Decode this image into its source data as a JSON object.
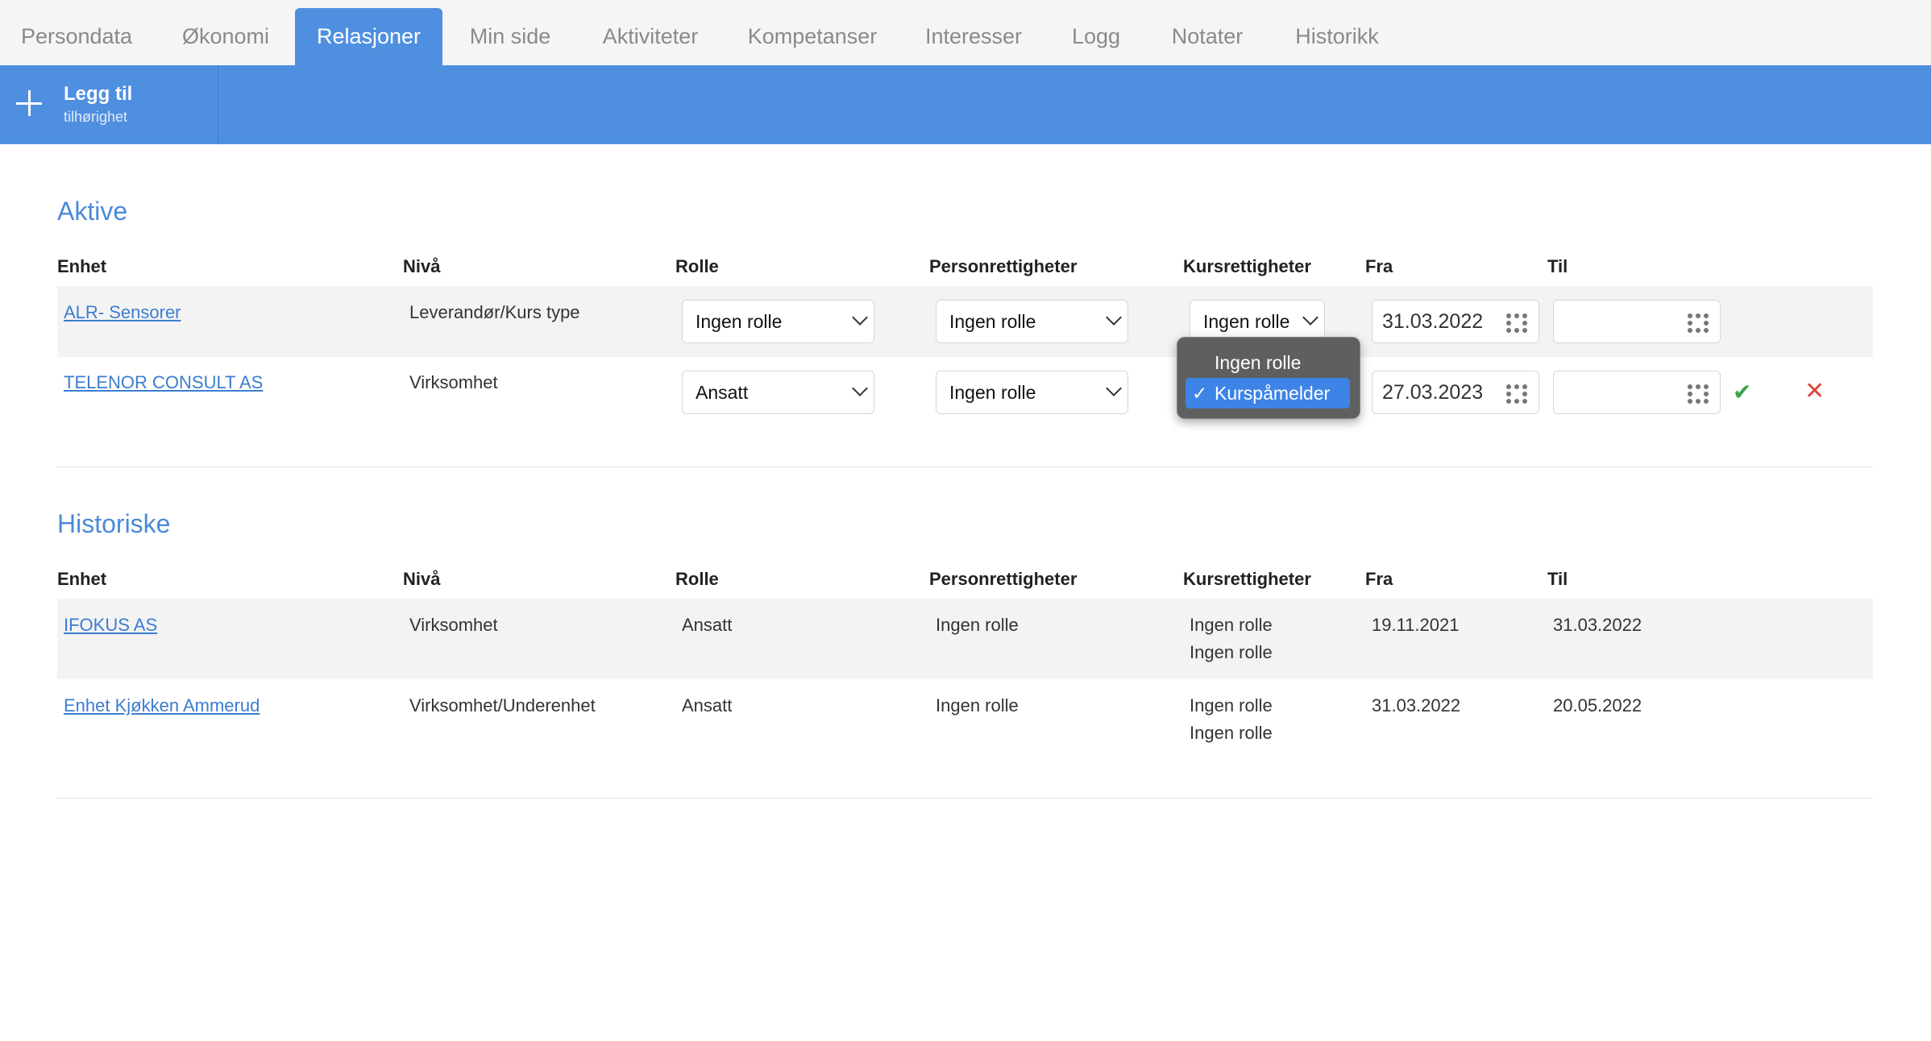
{
  "tabs": [
    {
      "label": "Persondata"
    },
    {
      "label": "Økonomi"
    },
    {
      "label": "Relasjoner"
    },
    {
      "label": "Min side"
    },
    {
      "label": "Aktiviteter"
    },
    {
      "label": "Kompetanser"
    },
    {
      "label": "Interesser"
    },
    {
      "label": "Logg"
    },
    {
      "label": "Notater"
    },
    {
      "label": "Historikk"
    }
  ],
  "toolbar": {
    "add_title": "Legg til",
    "add_sub": "tilhørighet"
  },
  "columns": {
    "enhet": "Enhet",
    "niva": "Nivå",
    "rolle": "Rolle",
    "personrett": "Personrettigheter",
    "kursrett": "Kursrettigheter",
    "fra": "Fra",
    "til": "Til"
  },
  "aktive": {
    "title": "Aktive",
    "rows": [
      {
        "enhet": "ALR- Sensorer",
        "niva": "Leverandør/Kurs type",
        "rolle": "Ingen rolle",
        "personrett": "Ingen rolle",
        "kursrett": "Ingen rolle",
        "fra": "31.03.2022",
        "til": ""
      },
      {
        "enhet": "TELENOR CONSULT AS",
        "niva": "Virksomhet",
        "rolle": "Ansatt",
        "personrett": "Ingen rolle",
        "kursrett": "Kurspåmelder",
        "fra": "27.03.2023",
        "til": ""
      }
    ]
  },
  "dropdown": {
    "options": [
      "Ingen rolle",
      "Kurspåmelder"
    ],
    "selected": "Kurspåmelder"
  },
  "historiske": {
    "title": "Historiske",
    "rows": [
      {
        "enhet": "IFOKUS AS",
        "niva": "Virksomhet",
        "rolle": "Ansatt",
        "personrett": "Ingen rolle",
        "kursrett1": "Ingen rolle",
        "kursrett2": "Ingen rolle",
        "fra": "19.11.2021",
        "til": "31.03.2022"
      },
      {
        "enhet": "Enhet Kjøkken Ammerud",
        "niva": "Virksomhet/Underenhet",
        "rolle": "Ansatt",
        "personrett": "Ingen rolle",
        "kursrett1": "Ingen rolle",
        "kursrett2": "Ingen rolle",
        "fra": "31.03.2022",
        "til": "20.05.2022"
      }
    ]
  },
  "icons": {
    "confirm": "check-icon",
    "cancel": "close-icon",
    "calendar": "calendar-icon",
    "add": "plus-icon"
  },
  "colors": {
    "accent": "#4f8fe0",
    "confirm": "#3fa34a",
    "cancel": "#e0453c"
  }
}
